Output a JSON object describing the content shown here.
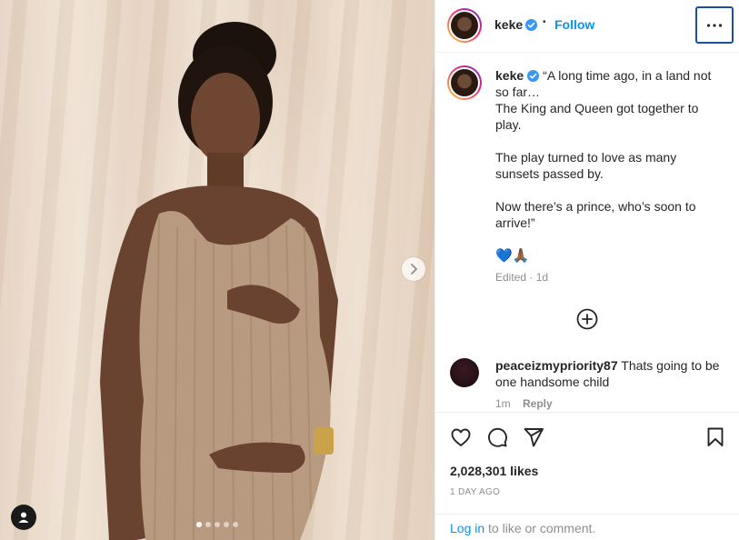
{
  "post": {
    "username": "keke",
    "verified": true,
    "follow_label": "Follow",
    "separator": "•",
    "carousel": {
      "total": 5,
      "current": 1
    }
  },
  "caption": {
    "text": "“A long time ago, in a land not so far…\nThe King and Queen got together to play.\n\nThe play turned to love as many sunsets passed by.\n\nNow there’s a prince, who’s soon to arrive!”",
    "emoji": "💙🙏🏾",
    "edited": "Edited · 1d"
  },
  "comments": [
    {
      "username": "peaceizmypriority87",
      "text": "Thats going to be one handsome child",
      "time": "1m",
      "reply_label": "Reply"
    }
  ],
  "stats": {
    "likes": "2,028,301 likes",
    "time_ago": "1 DAY AGO"
  },
  "login": {
    "link_text": "Log in",
    "rest_text": " to like or comment."
  },
  "icons": {
    "more": "more-options-icon",
    "like": "heart-icon",
    "comment": "comment-icon",
    "share": "paper-plane-icon",
    "save": "bookmark-icon",
    "add": "add-circle-icon",
    "next": "chevron-right-icon",
    "tag": "user-tag-icon"
  },
  "colors": {
    "accent": "#0095f6",
    "verified": "#3897f0",
    "text": "#262626",
    "muted": "#8e8e8e"
  }
}
